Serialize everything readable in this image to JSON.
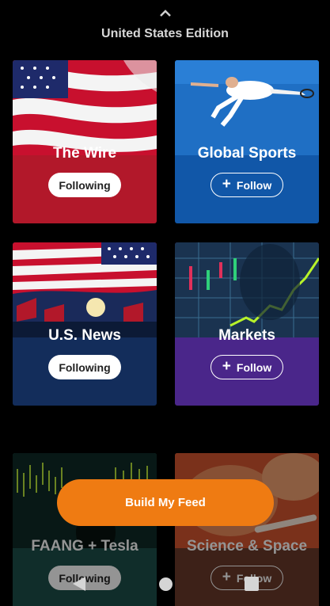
{
  "header": {
    "edition": "United States Edition",
    "collapse_icon": "chevron-up-icon"
  },
  "cards": [
    {
      "id": "wire",
      "title": "The Wire",
      "button": "Following",
      "state": "following"
    },
    {
      "id": "sports",
      "title": "Global Sports",
      "button": "Follow",
      "state": "follow"
    },
    {
      "id": "news",
      "title": "U.S. News",
      "button": "Following",
      "state": "following"
    },
    {
      "id": "markets",
      "title": "Markets",
      "button": "Follow",
      "state": "follow"
    },
    {
      "id": "faang",
      "title": "FAANG + Tesla",
      "button": "Following",
      "state": "following"
    },
    {
      "id": "science",
      "title": "Science & Space",
      "button": "Follow",
      "state": "follow"
    }
  ],
  "cta": {
    "label": "Build My Feed"
  },
  "nav": {
    "back_icon": "back-triangle-icon",
    "home_icon": "home-circle-icon",
    "recents_icon": "recents-square-icon"
  },
  "colors": {
    "wire": "#b2182a",
    "sports": "#1157a8",
    "news": "#132d5b",
    "markets": "#4a268a",
    "faang": "#1d4f49",
    "science": "#6a3a2a",
    "accent": "#ef7b12"
  }
}
